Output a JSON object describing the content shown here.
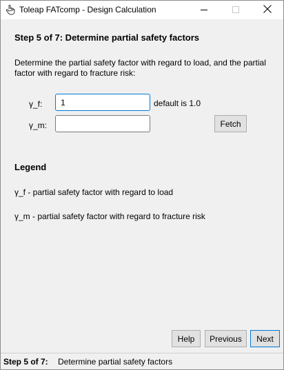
{
  "window": {
    "title": "Toleap FATcomp - Design Calculation",
    "app_icon": "hand-pointer-icon",
    "controls": [
      "minimize-icon",
      "maximize-icon",
      "close-icon"
    ]
  },
  "step": {
    "heading": "Step 5 of 7: Determine partial safety factors",
    "instructions": "Determine the partial safety factor with regard to load, and the partial factor with regard to fracture risk:"
  },
  "form": {
    "gamma_f": {
      "label": "γ_f:",
      "value": "1",
      "hint": "default is 1.0"
    },
    "gamma_m": {
      "label": "γ_m:",
      "value": ""
    },
    "fetch_label": "Fetch"
  },
  "legend": {
    "heading": "Legend",
    "items": [
      "γ_f - partial safety factor with regard to load",
      "γ_m - partial safety factor with regard to fracture risk"
    ]
  },
  "buttons": {
    "help": "Help",
    "previous": "Previous",
    "next": "Next"
  },
  "status": {
    "step": "Step 5 of 7:",
    "description": "Determine partial safety factors"
  },
  "colors": {
    "focus_accent": "#0078d7",
    "panel_background": "#f0f0f0"
  }
}
